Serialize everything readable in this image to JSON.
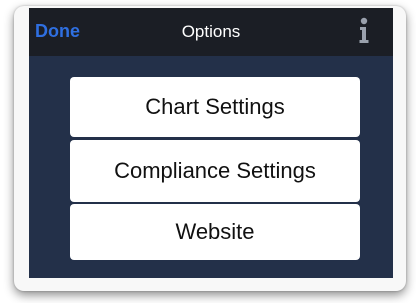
{
  "navbar": {
    "done_label": "Done",
    "title": "Options",
    "info_icon": "info-icon"
  },
  "menu": {
    "items": [
      {
        "label": "Chart Settings"
      },
      {
        "label": "Compliance Settings"
      },
      {
        "label": "Website"
      }
    ]
  },
  "colors": {
    "navbar_bg": "#1b1e25",
    "panel_bg": "#233049",
    "accent": "#2f6fe0",
    "button_bg": "#ffffff"
  }
}
